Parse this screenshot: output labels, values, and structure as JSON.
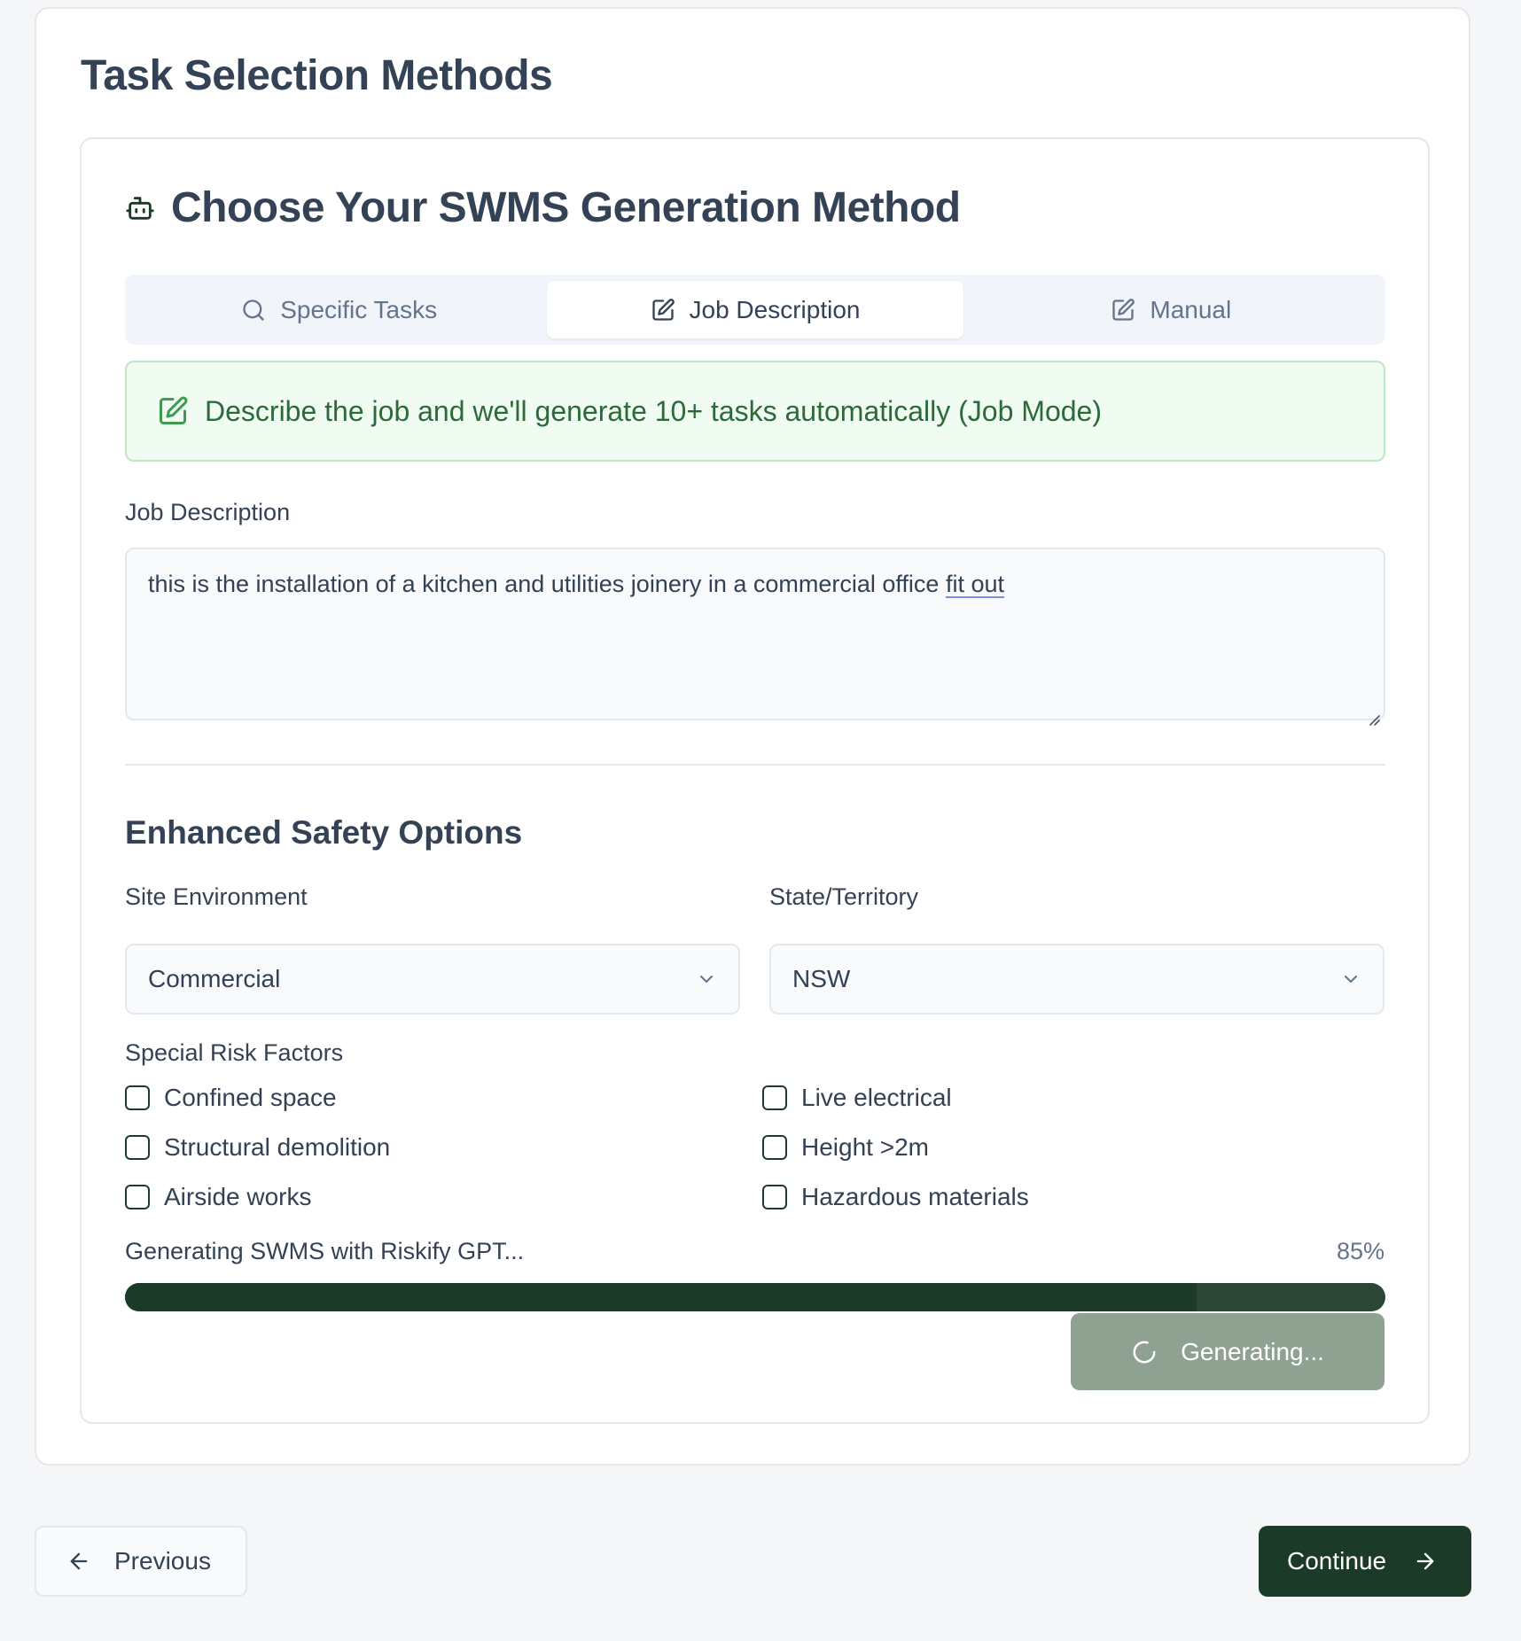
{
  "page": {
    "title": "Task Selection Methods"
  },
  "method_card": {
    "heading": "Choose Your SWMS Generation Method",
    "heading_icon": "bot-icon",
    "tabs": [
      {
        "label": "Specific Tasks",
        "icon": "search-icon",
        "active": false
      },
      {
        "label": "Job Description",
        "icon": "edit-icon",
        "active": true
      },
      {
        "label": "Manual",
        "icon": "edit-icon",
        "active": false
      }
    ],
    "banner": {
      "icon": "edit-icon",
      "text": "Describe the job and we'll generate 10+ tasks automatically (Job Mode)"
    },
    "job_description": {
      "label": "Job Description",
      "value_main": "this is the installation of a kitchen and utilities joinery in a commercial office ",
      "value_underlined": "fit out"
    }
  },
  "safety_options": {
    "heading": "Enhanced Safety Options",
    "site_environment": {
      "label": "Site Environment",
      "value": "Commercial"
    },
    "state_territory": {
      "label": "State/Territory",
      "value": "NSW"
    },
    "risk_factors": {
      "label": "Special Risk Factors",
      "items": [
        {
          "label": "Confined space",
          "checked": false
        },
        {
          "label": "Live electrical",
          "checked": false
        },
        {
          "label": "Structural demolition",
          "checked": false
        },
        {
          "label": "Height >2m",
          "checked": false
        },
        {
          "label": "Airside works",
          "checked": false
        },
        {
          "label": "Hazardous materials",
          "checked": false
        }
      ]
    }
  },
  "progress": {
    "label": "Generating SWMS with Riskify GPT...",
    "percent_text": "85%",
    "value": 0.85
  },
  "generate_button": {
    "label": "Generating..."
  },
  "navigation": {
    "previous_label": "Previous",
    "continue_label": "Continue"
  },
  "colors": {
    "brand_dark_green": "#1b3b28",
    "banner_bg": "#f0fbf2",
    "banner_text": "#2d6a3a",
    "disabled_button": "#8fa190"
  }
}
